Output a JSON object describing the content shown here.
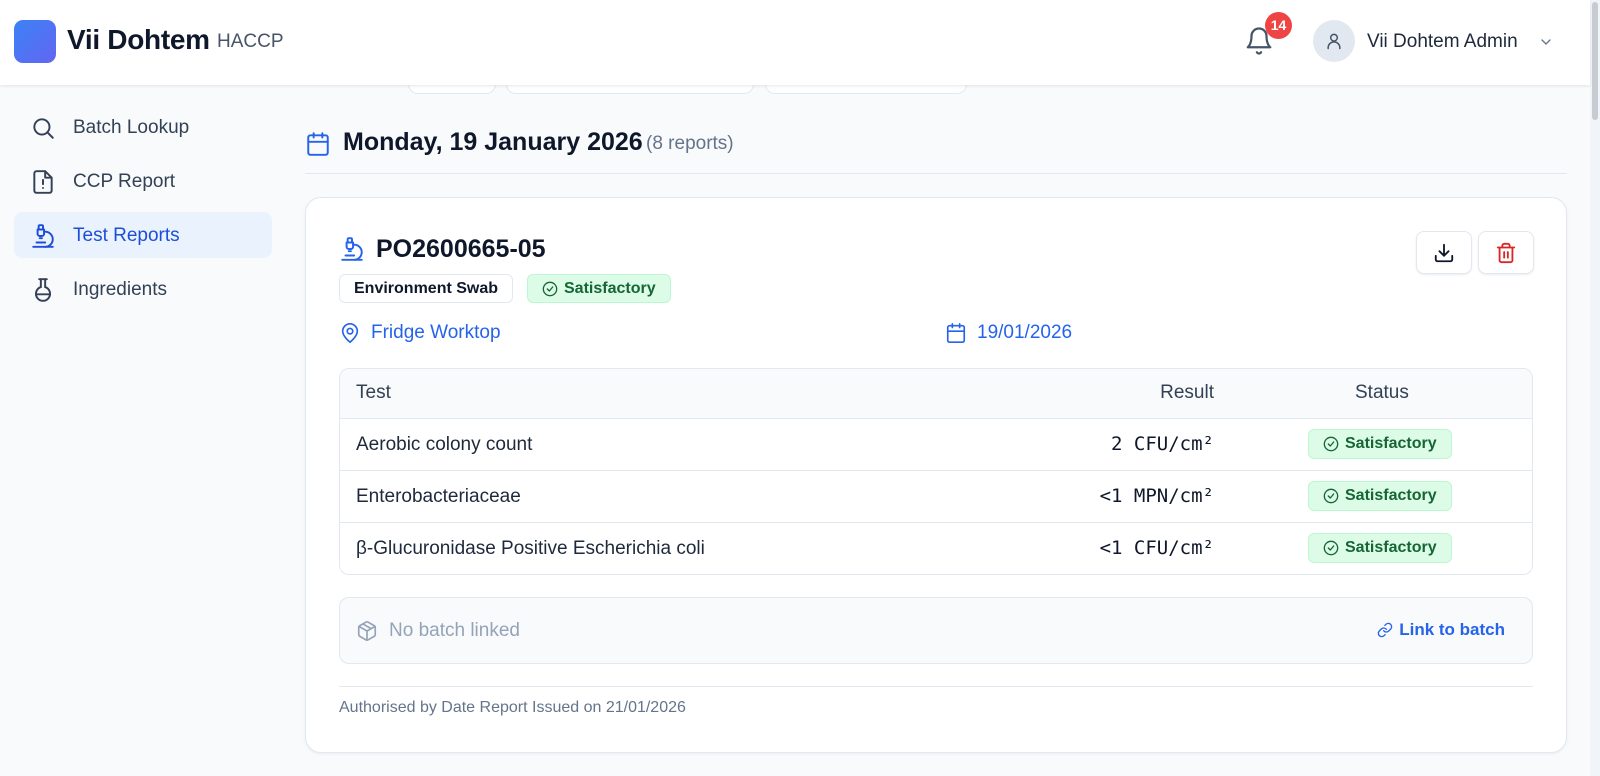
{
  "header": {
    "brand": "Vii Dohtem",
    "subtitle": "HACCP",
    "notification_count": "14",
    "user_name": "Vii Dohtem Admin"
  },
  "sidebar": {
    "items": [
      {
        "label": "Batch Lookup",
        "icon": "search-icon",
        "active": false
      },
      {
        "label": "CCP Report",
        "icon": "file-alert-icon",
        "active": false
      },
      {
        "label": "Test Reports",
        "icon": "microscope-icon",
        "active": true
      },
      {
        "label": "Ingredients",
        "icon": "flask-icon",
        "active": false
      }
    ]
  },
  "date_group": {
    "title": "Monday, 19 January 2026",
    "count": "(8 reports)"
  },
  "report": {
    "id": "PO2600665-05",
    "type": "Environment Swab",
    "status": "Satisfactory",
    "location": "Fridge Worktop",
    "date": "19/01/2026",
    "table": {
      "headers": {
        "test": "Test",
        "result": "Result",
        "status": "Status"
      },
      "rows": [
        {
          "test": "Aerobic colony count",
          "result": "2 CFU/cm²",
          "status": "Satisfactory"
        },
        {
          "test": "Enterobacteriaceae",
          "result": "<1 MPN/cm²",
          "status": "Satisfactory"
        },
        {
          "test": "β-Glucuronidase Positive Escherichia coli",
          "result": "<1 CFU/cm²",
          "status": "Satisfactory"
        }
      ]
    },
    "batch": {
      "text": "No batch linked",
      "link_label": "Link to batch"
    },
    "authorised": "Authorised by Date Report Issued on 21/01/2026"
  },
  "colors": {
    "accent": "#2563eb",
    "active_bg": "#eaf2fd",
    "success_bg": "#dcfce7",
    "success_text": "#166534",
    "danger": "#dc2626",
    "badge_red": "#ef4444"
  }
}
